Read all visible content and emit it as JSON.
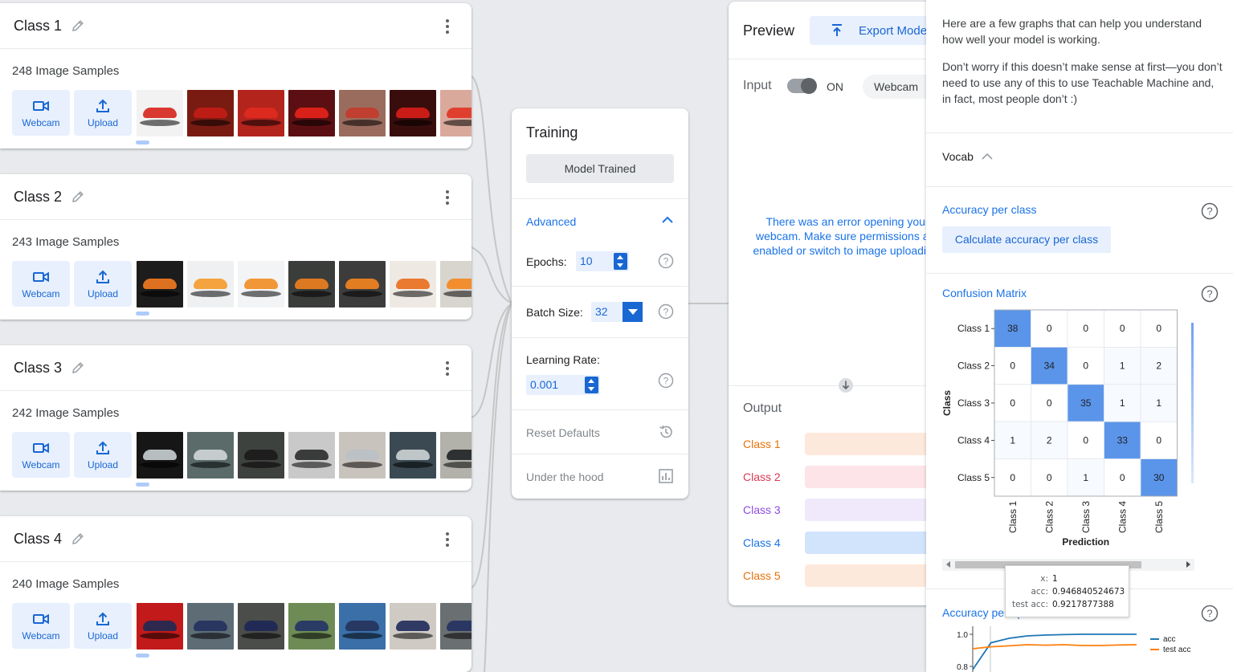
{
  "classes": [
    {
      "name": "Class 1",
      "samples": "248 Image Samples",
      "webcam_label": "Webcam",
      "upload_label": "Upload",
      "thumb_colors": [
        "#f2f2f2",
        "#7a1b12",
        "#b3241d",
        "#5c0f12",
        "#9a6c5d",
        "#3a0d0d",
        "#d9a99c"
      ],
      "car_colors": [
        "#d6241b",
        "#c41d16",
        "#e02b20",
        "#e8231b",
        "#c43b2b",
        "#d91e18",
        "#e03325"
      ]
    },
    {
      "name": "Class 2",
      "samples": "243 Image Samples",
      "webcam_label": "Webcam",
      "upload_label": "Upload",
      "thumb_colors": [
        "#1c1c1c",
        "#eef0f2",
        "#f2f4f6",
        "#3a3d3a",
        "#3c3c3c",
        "#efe9e4",
        "#d8d5cf"
      ],
      "car_colors": [
        "#f47b20",
        "#f49a2b",
        "#f28d22",
        "#ef7f1f",
        "#f5841f",
        "#e86e1b",
        "#f5861d"
      ]
    },
    {
      "name": "Class 3",
      "samples": "242 Image Samples",
      "webcam_label": "Webcam",
      "upload_label": "Upload",
      "thumb_colors": [
        "#161616",
        "#5a6b6a",
        "#3e423e",
        "#c8c9c8",
        "#c9c3be",
        "#3b4a52",
        "#b2b1aa"
      ],
      "car_colors": [
        "#c9d0d2",
        "#d2d7d8",
        "#1b1b1b",
        "#2a2c2b",
        "#b9c1c4",
        "#ced4d4",
        "#1f2424"
      ]
    },
    {
      "name": "Class 4",
      "samples": "240 Image Samples",
      "webcam_label": "Webcam",
      "upload_label": "Upload",
      "thumb_colors": [
        "#c21a1a",
        "#5d6c75",
        "#4b4d4a",
        "#6e8b55",
        "#3a6fa8",
        "#cfcbc4",
        "#6a6f71"
      ],
      "car_colors": [
        "#1e2a55",
        "#22315e",
        "#1c2756",
        "#243366",
        "#26325b",
        "#1e2a5a",
        "#233160"
      ]
    }
  ],
  "training": {
    "title": "Training",
    "button": "Model Trained",
    "advanced": "Advanced",
    "epochs_label": "Epochs:",
    "epochs_value": "10",
    "batch_label": "Batch Size:",
    "batch_value": "32",
    "lr_label": "Learning Rate:",
    "lr_value": "0.001",
    "reset": "Reset Defaults",
    "under_hood": "Under the hood"
  },
  "preview": {
    "title": "Preview",
    "export": "Export Mode",
    "input_label": "Input",
    "toggle_state": "ON",
    "source": "Webcam",
    "error": "There was an error opening your webcam. Make sure permissions are enabled or switch to image uploading.",
    "output_label": "Output",
    "outputs": [
      {
        "label": "Class 1",
        "color": "#e8710a",
        "bar": "#fde9dc"
      },
      {
        "label": "Class 2",
        "color": "#d93954",
        "bar": "#fce4e8"
      },
      {
        "label": "Class 3",
        "color": "#8e4be0",
        "bar": "#efe9fb"
      },
      {
        "label": "Class 4",
        "color": "#1a73e8",
        "bar": "#d2e3fc"
      },
      {
        "label": "Class 5",
        "color": "#e8710a",
        "bar": "#fde9dc"
      }
    ]
  },
  "panel": {
    "intro_1": "Here are a few graphs that can help you understand how well your model is working.",
    "intro_2": "Don’t worry if this doesn’t make sense at first—you don’t need to use any of this to use Teachable Machine and, in fact, most people don’t :)",
    "vocab": "Vocab",
    "accuracy_per_class": "Accuracy per class",
    "calc_button": "Calculate accuracy per class",
    "confusion_matrix": "Confusion Matrix",
    "accuracy_per_epoch": "Accuracy per epoch",
    "legend": [
      "acc",
      "test acc"
    ],
    "tooltip": {
      "x_key": "x:",
      "x": "1",
      "acc_key": "acc:",
      "acc": "0.946840524673",
      "test_key": "test acc:",
      "test": "0.9217877388"
    }
  },
  "chart_data": [
    {
      "type": "heatmap",
      "title": "Confusion Matrix",
      "xlabel": "Prediction",
      "ylabel": "Class",
      "x_categories": [
        "Class 1",
        "Class 2",
        "Class 3",
        "Class 4",
        "Class 5"
      ],
      "y_categories": [
        "Class 1",
        "Class 2",
        "Class 3",
        "Class 4",
        "Class 5"
      ],
      "values": [
        [
          38,
          0,
          0,
          0,
          0
        ],
        [
          0,
          34,
          0,
          1,
          2
        ],
        [
          0,
          0,
          35,
          1,
          1
        ],
        [
          1,
          2,
          0,
          33,
          0
        ],
        [
          0,
          0,
          1,
          0,
          30
        ]
      ]
    },
    {
      "type": "line",
      "title": "Accuracy per epoch",
      "y_ticks": [
        "1.0",
        "0.8"
      ],
      "series": [
        {
          "name": "acc",
          "color": "#1f77b4",
          "x": [
            0,
            1,
            2,
            3,
            4,
            5,
            6,
            7,
            8,
            9
          ],
          "values": [
            0.78,
            0.947,
            0.975,
            0.99,
            0.995,
            0.998,
            1.0,
            1.0,
            1.0,
            1.0
          ]
        },
        {
          "name": "test acc",
          "color": "#ff7f0e",
          "x": [
            0,
            1,
            2,
            3,
            4,
            5,
            6,
            7,
            8,
            9
          ],
          "values": [
            0.91,
            0.922,
            0.928,
            0.935,
            0.932,
            0.935,
            0.93,
            0.93,
            0.933,
            0.935
          ]
        }
      ]
    }
  ]
}
